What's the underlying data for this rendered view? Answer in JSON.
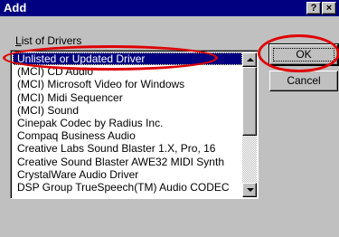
{
  "window": {
    "title": "Add",
    "help_button": "?",
    "close_button": "×"
  },
  "list": {
    "label_prefix": "",
    "label_mnemonic": "L",
    "label_rest": "ist of Drivers",
    "items": [
      "Unlisted or Updated Driver",
      "(MCI) CD Audio",
      "(MCI) Microsoft Video for Windows",
      "(MCI) Midi Sequencer",
      "(MCI) Sound",
      "Cinepak Codec by Radius Inc.",
      "Compaq Business Audio",
      "Creative Labs Sound Blaster 1.X, Pro, 16",
      "Creative Sound Blaster AWE32 MIDI Synth",
      "CrystalWare Audio Driver",
      "DSP Group TrueSpeech(TM) Audio CODEC"
    ],
    "selected_index": 0
  },
  "buttons": {
    "ok": "OK",
    "cancel": "Cancel"
  },
  "colors": {
    "titlebar": "#000080",
    "selection": "#000080",
    "annotation": "#e00000",
    "face": "#c0c0c0"
  }
}
